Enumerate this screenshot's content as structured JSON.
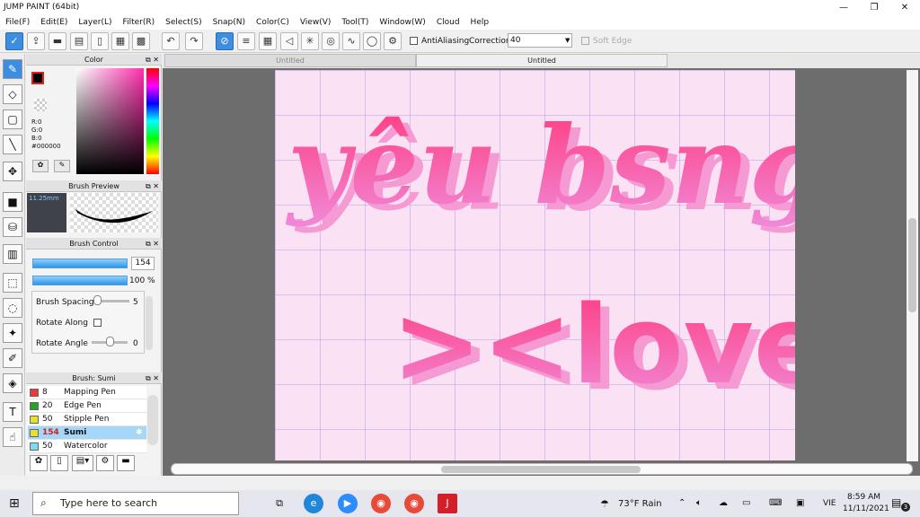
{
  "app": {
    "title": "JUMP PAINT (64bit)",
    "win_min": "—",
    "win_max": "❐",
    "win_close": "✕"
  },
  "menu": [
    "File(F)",
    "Edit(E)",
    "Layer(L)",
    "Filter(R)",
    "Select(S)",
    "Snap(N)",
    "Color(C)",
    "View(V)",
    "Tool(T)",
    "Window(W)",
    "Cloud",
    "Help"
  ],
  "toolbar": {
    "antialiasing": "AntiAliasing",
    "correction_label": "Correction",
    "correction_value": "40",
    "soft_edge": "Soft Edge"
  },
  "tabs": [
    "Untitled",
    "Untitled"
  ],
  "color_panel": {
    "title": "Color",
    "r": "R:0",
    "g": "G:0",
    "b": "B:0",
    "hex": "#000000"
  },
  "brush_preview": {
    "title": "Brush Preview",
    "size": "11.25mm"
  },
  "brush_control": {
    "title": "Brush Control",
    "size_value": "154",
    "opacity_value": "100 %",
    "spacing_label": "Brush Spacing",
    "spacing_value": "5",
    "rotate_along": "Rotate Along",
    "rotate_angle": "Rotate Angle",
    "rotate_value": "0"
  },
  "brush_list": {
    "title": "Brush: Sumi",
    "items": [
      {
        "num": "8",
        "label": "Mapping Pen",
        "color": "#e83a3a"
      },
      {
        "num": "20",
        "label": "Edge Pen",
        "color": "#2aa02a"
      },
      {
        "num": "50",
        "label": "Stipple Pen",
        "color": "#e8e030"
      },
      {
        "num": "154",
        "label": "Sumi",
        "color": "#e8e030"
      },
      {
        "num": "50",
        "label": "Watercolor",
        "color": "#7fdcf0"
      }
    ]
  },
  "canvas_text": {
    "line1": "yêu bsng",
    "line2": "><love"
  },
  "taskbar": {
    "search_placeholder": "Type here to search",
    "weather": "73°F  Rain",
    "lang": "VIE",
    "time": "8:59 AM",
    "date": "11/11/2021",
    "notif": "3"
  }
}
